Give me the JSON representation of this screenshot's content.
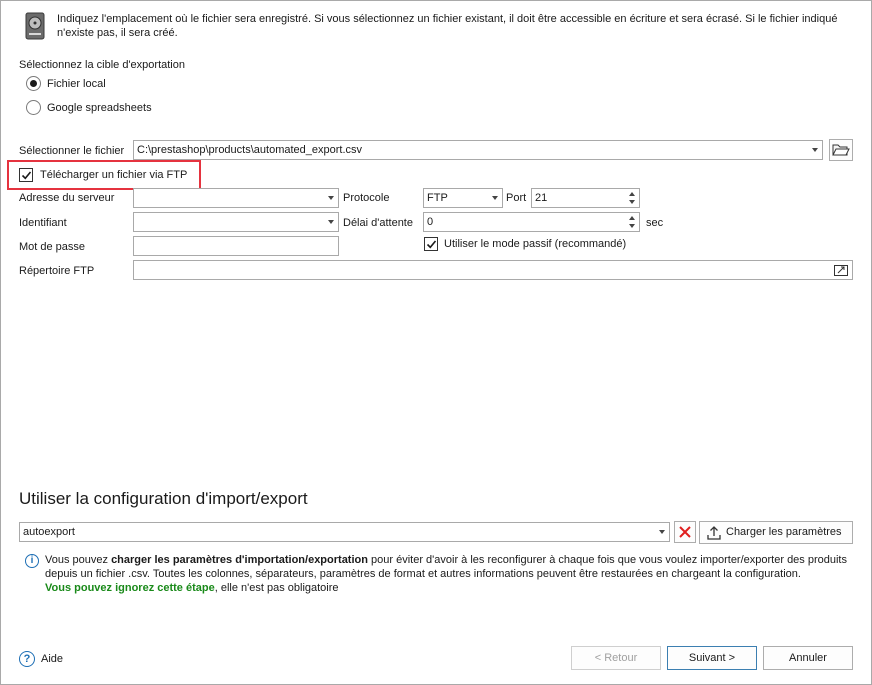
{
  "header": {
    "icon": "hard-disk-icon",
    "description": "Indiquez l'emplacement où le fichier sera enregistré. Si vous sélectionnez un fichier existant, il doit être accessible en écriture et sera écrasé. Si le fichier indiqué n'existe pas, il sera créé."
  },
  "export_target": {
    "label": "Sélectionnez la cible d'exportation",
    "options": [
      {
        "label": "Fichier local",
        "selected": true
      },
      {
        "label": "Google spreadsheets",
        "selected": false
      }
    ]
  },
  "file": {
    "label": "Sélectionner le fichier",
    "value": "C:\\prestashop\\products\\automated_export.csv",
    "browse_icon": "folder-open-icon"
  },
  "ftp": {
    "checkbox_label": "Télécharger un fichier via FTP",
    "checked": true,
    "server_label": "Adresse du serveur",
    "server_value": "",
    "login_label": "Identifiant",
    "login_value": "",
    "password_label": "Mot de passe",
    "password_value": "",
    "protocol_label": "Protocole",
    "protocol_value": "FTP",
    "port_label": "Port",
    "port_value": "21",
    "timeout_label": "Délai d'attente",
    "timeout_value": "0",
    "timeout_unit": "sec",
    "passive_label": "Utiliser le mode passif (recommandé)",
    "passive_checked": true,
    "dir_label": "Répertoire FTP",
    "dir_value": "",
    "dir_browse_icon": "folder-browse-icon"
  },
  "config": {
    "title": "Utiliser la configuration d'import/export",
    "value": "autoexport",
    "clear_icon": "red-x-icon",
    "load_button": "Charger les paramètres",
    "load_icon": "upload-icon",
    "info_icon": "info-icon",
    "info_part1": "Vous pouvez ",
    "info_bold": "charger les paramètres d'importation/exportation",
    "info_part2": " pour éviter d'avoir à les reconfigurer à chaque fois que vous voulez importer/exporter des produits depuis un fichier .csv. Toutes les colonnes, séparateurs, paramètres de format et autres informations peuvent être restaurées en chargeant la configuration.",
    "info_green": "Vous pouvez ignorez cette étape",
    "info_part3": ", elle n'est pas obligatoire"
  },
  "footer": {
    "help_label": "Aide",
    "help_icon": "help-icon",
    "back_button": "< Retour",
    "next_button": "Suivant >",
    "cancel_button": "Annuler"
  },
  "colors": {
    "highlight": "#e5333f",
    "accent": "#1e6fb5",
    "success": "#1a8a1a"
  }
}
